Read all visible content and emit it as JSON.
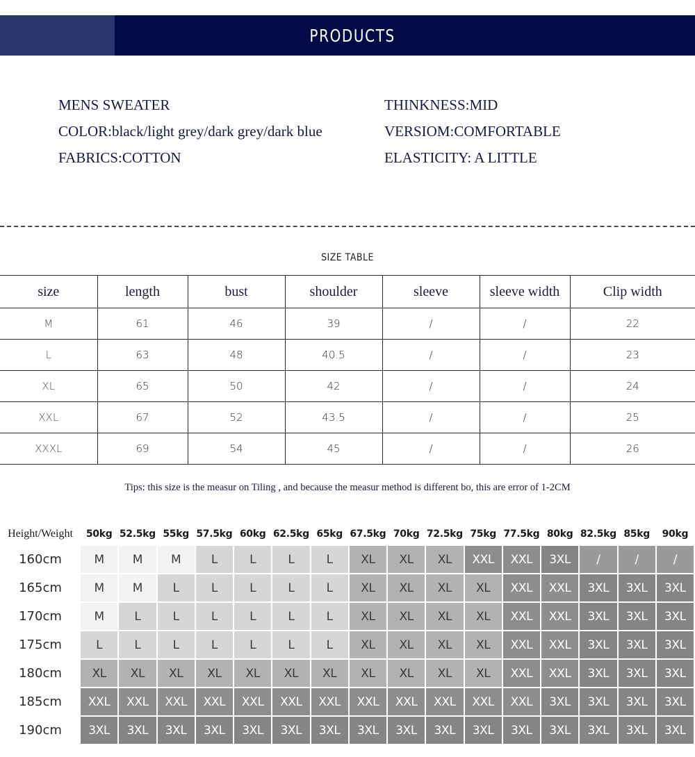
{
  "banner": {
    "title": "PRODUCTS",
    "bg_color": "#020b47",
    "left_block_color": "#28346a"
  },
  "specs": {
    "left": [
      "MENS SWEATER",
      "COLOR:black/light grey/dark grey/dark blue",
      "FABRICS:COTTON"
    ],
    "right": [
      "THINKNESS:MID",
      "VERSIOM:COMFORTABLE",
      "ELASTICITY: A LITTLE"
    ]
  },
  "size_table": {
    "caption": "SIZE TABLE",
    "columns": [
      "size",
      "length",
      "bust",
      "shoulder",
      "sleeve",
      "sleeve width",
      "Clip width"
    ],
    "rows": [
      [
        "M",
        "61",
        "46",
        "39",
        "/",
        "/",
        "22"
      ],
      [
        "L",
        "63",
        "48",
        "40.5",
        "/",
        "/",
        "23"
      ],
      [
        "XL",
        "65",
        "50",
        "42",
        "/",
        "/",
        "24"
      ],
      [
        "XXL",
        "67",
        "52",
        "43.5",
        "/",
        "/",
        "25"
      ],
      [
        "XXXL",
        "69",
        "54",
        "45",
        "/",
        "/",
        "26"
      ]
    ]
  },
  "tips": "Tips: this size is the measur on Tiling , and because the measur method is different bo, this are error of 1-2CM",
  "height_weight": {
    "corner_label": "Height/Weight",
    "weights": [
      "50kg",
      "52.5kg",
      "55kg",
      "57.5kg",
      "60kg",
      "62.5kg",
      "65kg",
      "67.5kg",
      "70kg",
      "72.5kg",
      "75kg",
      "77.5kg",
      "80kg",
      "82.5kg",
      "85kg",
      "90kg"
    ],
    "heights": [
      "160cm",
      "165cm",
      "170cm",
      "175cm",
      "180cm",
      "185cm",
      "190cm"
    ],
    "cells": [
      [
        "M",
        "M",
        "M",
        "L",
        "L",
        "L",
        "L",
        "XL",
        "XL",
        "XL",
        "XXL",
        "XXL",
        "3XL",
        "/",
        "/",
        "/"
      ],
      [
        "M",
        "M",
        "L",
        "L",
        "L",
        "L",
        "L",
        "XL",
        "XL",
        "XL",
        "XL",
        "XXL",
        "XXL",
        "3XL",
        "3XL",
        "3XL"
      ],
      [
        "M",
        "L",
        "L",
        "L",
        "L",
        "L",
        "L",
        "XL",
        "XL",
        "XL",
        "XL",
        "XXL",
        "XXL",
        "3XL",
        "3XL",
        "3XL"
      ],
      [
        "L",
        "L",
        "L",
        "L",
        "L",
        "L",
        "L",
        "XL",
        "XL",
        "XL",
        "XL",
        "XXL",
        "XXL",
        "3XL",
        "3XL",
        "3XL"
      ],
      [
        "XL",
        "XL",
        "XL",
        "XL",
        "XL",
        "XL",
        "XL",
        "XL",
        "XL",
        "XL",
        "XL",
        "XXL",
        "XXL",
        "3XL",
        "3XL",
        "3XL"
      ],
      [
        "XXL",
        "XXL",
        "XXL",
        "XXL",
        "XXL",
        "XXL",
        "XXL",
        "XXL",
        "XXL",
        "XXL",
        "XXL",
        "XXL",
        "3XL",
        "3XL",
        "3XL",
        "3XL"
      ],
      [
        "3XL",
        "3XL",
        "3XL",
        "3XL",
        "3XL",
        "3XL",
        "3XL",
        "3XL",
        "3XL",
        "3XL",
        "3XL",
        "3XL",
        "3XL",
        "3XL",
        "3XL",
        "3XL"
      ]
    ],
    "level_colors": {
      "M": "#f3f3f3",
      "L": "#d6d6d6",
      "XL": "#b2b2b2",
      "XXL": "#8d8d8d",
      "3XL": "#858585",
      "/": "#9a9a9a"
    }
  }
}
